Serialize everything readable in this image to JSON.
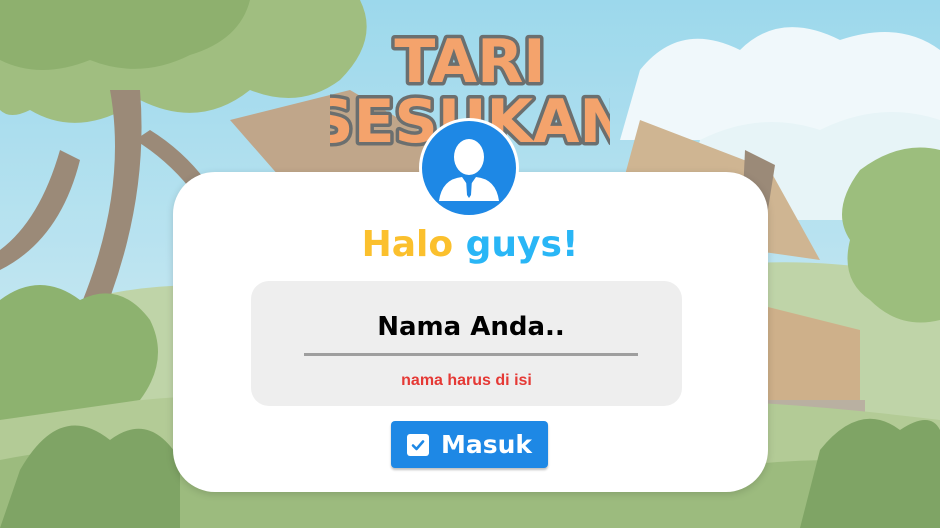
{
  "logo": {
    "line1": "TARI",
    "line2": "SESUKAN"
  },
  "greeting": {
    "word1": "Halo",
    "word2": "guys",
    "punct": "!"
  },
  "name_input": {
    "placeholder": "Nama Anda..",
    "value": ""
  },
  "error_text": "nama harus di isi",
  "submit_button": {
    "label": "Masuk",
    "icon": "checkbox-icon"
  },
  "colors": {
    "primary": "#1e88e5",
    "error": "#e53935",
    "greeting_yellow": "#fbc02d",
    "greeting_blue": "#29b6f6",
    "logo_fill": "#f4a36c"
  }
}
